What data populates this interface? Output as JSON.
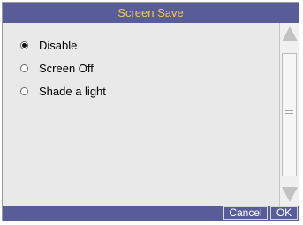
{
  "dialog": {
    "title": "Screen Save",
    "options": [
      {
        "label": "Disable",
        "selected": true
      },
      {
        "label": "Screen Off",
        "selected": false
      },
      {
        "label": "Shade a light",
        "selected": false
      }
    ],
    "cancel_label": "Cancel",
    "ok_label": "OK"
  },
  "colors": {
    "titlebar_bg": "#585c98",
    "title_text": "#f2d03a",
    "panel_bg": "#e9e9e9"
  },
  "icons": {
    "scroll_up": "triangle-up",
    "scroll_down": "triangle-down",
    "scroll_thumb_grip": "three-lines"
  }
}
